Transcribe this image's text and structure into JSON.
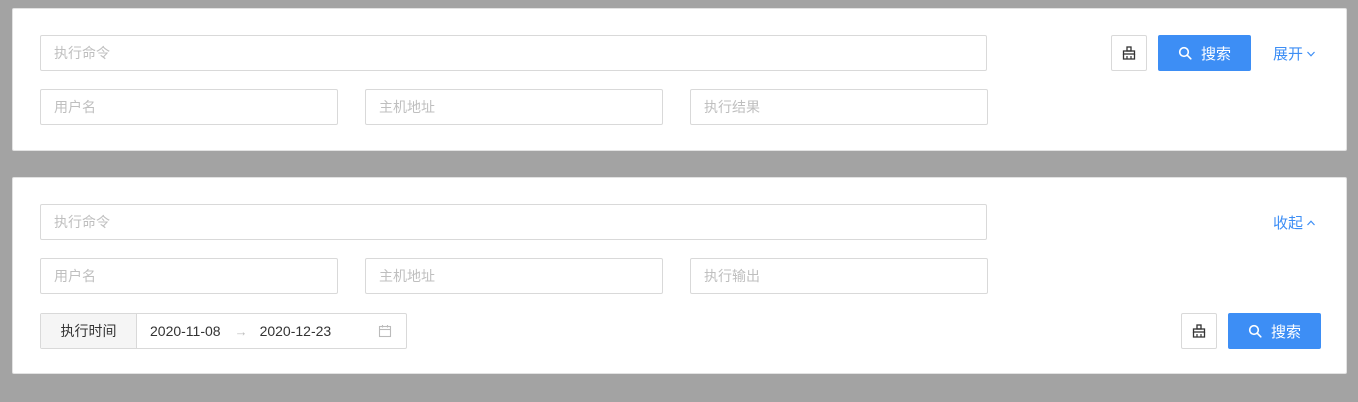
{
  "panel_collapsed": {
    "command_input": {
      "placeholder": "执行命令"
    },
    "username_input": {
      "placeholder": "用户名"
    },
    "host_input": {
      "placeholder": "主机地址"
    },
    "result_input": {
      "placeholder": "执行结果"
    },
    "clear_icon": "broom-icon",
    "search_label": "搜索",
    "expand_label": "展开"
  },
  "panel_expanded": {
    "command_input": {
      "placeholder": "执行命令"
    },
    "username_input": {
      "placeholder": "用户名"
    },
    "host_input": {
      "placeholder": "主机地址"
    },
    "output_input": {
      "placeholder": "执行输出"
    },
    "time_range": {
      "label": "执行时间",
      "start": "2020-11-08",
      "end": "2020-12-23"
    },
    "clear_icon": "broom-icon",
    "search_label": "搜索",
    "collapse_label": "收起"
  },
  "colors": {
    "accent": "#3d8ef5",
    "backdrop": "#a3a3a3",
    "placeholder": "#bfbfbf",
    "border": "#d9d9d9"
  }
}
